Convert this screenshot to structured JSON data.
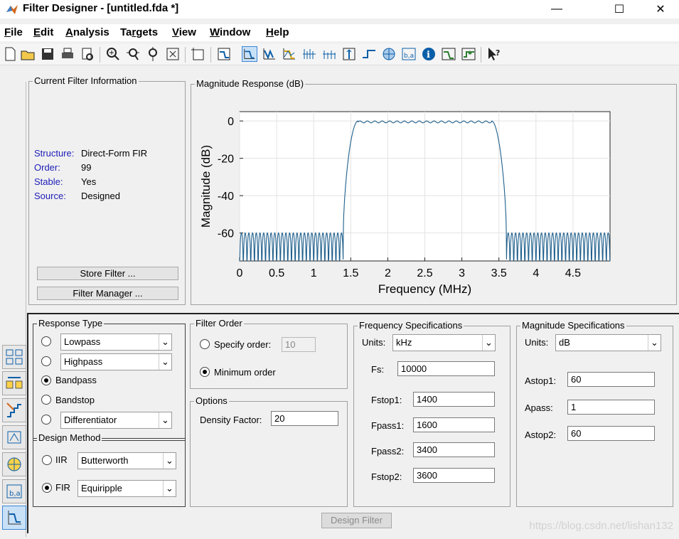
{
  "window": {
    "title": "Filter Designer -  [untitled.fda *]",
    "minimize": "—",
    "maximize": "☐",
    "close": "✕"
  },
  "menu": [
    {
      "label": "File",
      "u": "F",
      "rest": "ile"
    },
    {
      "label": "Edit",
      "u": "E",
      "rest": "dit"
    },
    {
      "label": "Analysis",
      "u": "A",
      "rest": "nalysis"
    },
    {
      "label": "Targets",
      "pre": "Ta",
      "u": "r",
      "rest": "gets"
    },
    {
      "label": "View",
      "u": "V",
      "rest": "iew"
    },
    {
      "label": "Window",
      "u": "W",
      "rest": "indow"
    },
    {
      "label": "Help",
      "u": "H",
      "rest": "elp"
    }
  ],
  "toolbar": {
    "icons": [
      "new-file-icon",
      "open-folder-icon",
      "save-icon",
      "print-icon",
      "print-preview-icon",
      "zoom-in-icon",
      "zoom-x-icon",
      "zoom-y-icon",
      "full-view-icon",
      "new-figure-icon",
      "filter-specs-icon",
      "magnitude-response-icon",
      "phase-response-icon",
      "magnitude-phase-icon",
      "group-delay-icon",
      "phase-delay-icon",
      "impulse-response-icon",
      "step-response-icon",
      "pole-zero-icon",
      "filter-coefficients-icon",
      "filter-info-icon",
      "magnitude-estimate-icon",
      "round-off-noise-icon",
      "whats-this-icon"
    ],
    "active": "magnitude-response-icon"
  },
  "current_filter": {
    "title": "Current Filter Information",
    "rows": [
      {
        "key": "Structure:",
        "value": "Direct-Form FIR"
      },
      {
        "key": "Order:",
        "value": "99"
      },
      {
        "key": "Stable:",
        "value": "Yes"
      },
      {
        "key": "Source:",
        "value": "Designed"
      }
    ],
    "store_button": "Store Filter ...",
    "manager_button": "Filter Manager ..."
  },
  "plot": {
    "panel_title": "Magnitude Response (dB)",
    "chart_data": {
      "type": "line",
      "title": "",
      "xlabel": "Frequency (MHz)",
      "ylabel": "Magnitude (dB)",
      "xlim": [
        0,
        5
      ],
      "ylim": [
        -75,
        5
      ],
      "xticks": [
        "0",
        "0.5",
        "1",
        "1.5",
        "2",
        "2.5",
        "3",
        "3.5",
        "4",
        "4.5"
      ],
      "yticks": [
        "0",
        "-20",
        "-40",
        "-60"
      ],
      "grid": true,
      "passband": [
        1.6,
        3.4
      ],
      "stopband_edges": [
        1.4,
        3.6
      ],
      "stopband_level_db": -60,
      "passband_ripple_db": 1
    }
  },
  "response_type": {
    "title": "Response Type",
    "options": [
      {
        "label": "Lowpass",
        "selected": false,
        "type": "select"
      },
      {
        "label": "Highpass",
        "selected": false,
        "type": "select"
      },
      {
        "label": "Bandpass",
        "selected": true,
        "type": "text"
      },
      {
        "label": "Bandstop",
        "selected": false,
        "type": "text"
      },
      {
        "label": "Differentiator",
        "selected": false,
        "type": "select"
      }
    ]
  },
  "design_method": {
    "title": "Design Method",
    "iir_label": "IIR",
    "iir_value": "Butterworth",
    "fir_label": "FIR",
    "fir_value": "Equiripple",
    "selected": "FIR"
  },
  "filter_order": {
    "title": "Filter Order",
    "specify_label": "Specify order:",
    "specify_value": "10",
    "minimum_label": "Minimum order",
    "selected": "minimum"
  },
  "options": {
    "title": "Options",
    "density_label": "Density Factor:",
    "density_value": "20"
  },
  "freq_specs": {
    "title": "Frequency Specifications",
    "units_label": "Units:",
    "units_value": "kHz",
    "fields": [
      {
        "label": "Fs:",
        "value": "10000"
      },
      {
        "label": "Fstop1:",
        "value": "1400"
      },
      {
        "label": "Fpass1:",
        "value": "1600"
      },
      {
        "label": "Fpass2:",
        "value": "3400"
      },
      {
        "label": "Fstop2:",
        "value": "3600"
      }
    ]
  },
  "mag_specs": {
    "title": "Magnitude Specifications",
    "units_label": "Units:",
    "units_value": "dB",
    "fields": [
      {
        "label": "Astop1:",
        "value": "60"
      },
      {
        "label": "Apass:",
        "value": "1"
      },
      {
        "label": "Astop2:",
        "value": "60"
      }
    ]
  },
  "design_button": "Design Filter",
  "watermark": "https://blog.csdn.net/lishan132",
  "colors": {
    "accent": "#0b5ea8",
    "plot_line": "#1f5f8c",
    "link_blue": "#1c1cb8",
    "active_btn": "#c9e1f7"
  }
}
